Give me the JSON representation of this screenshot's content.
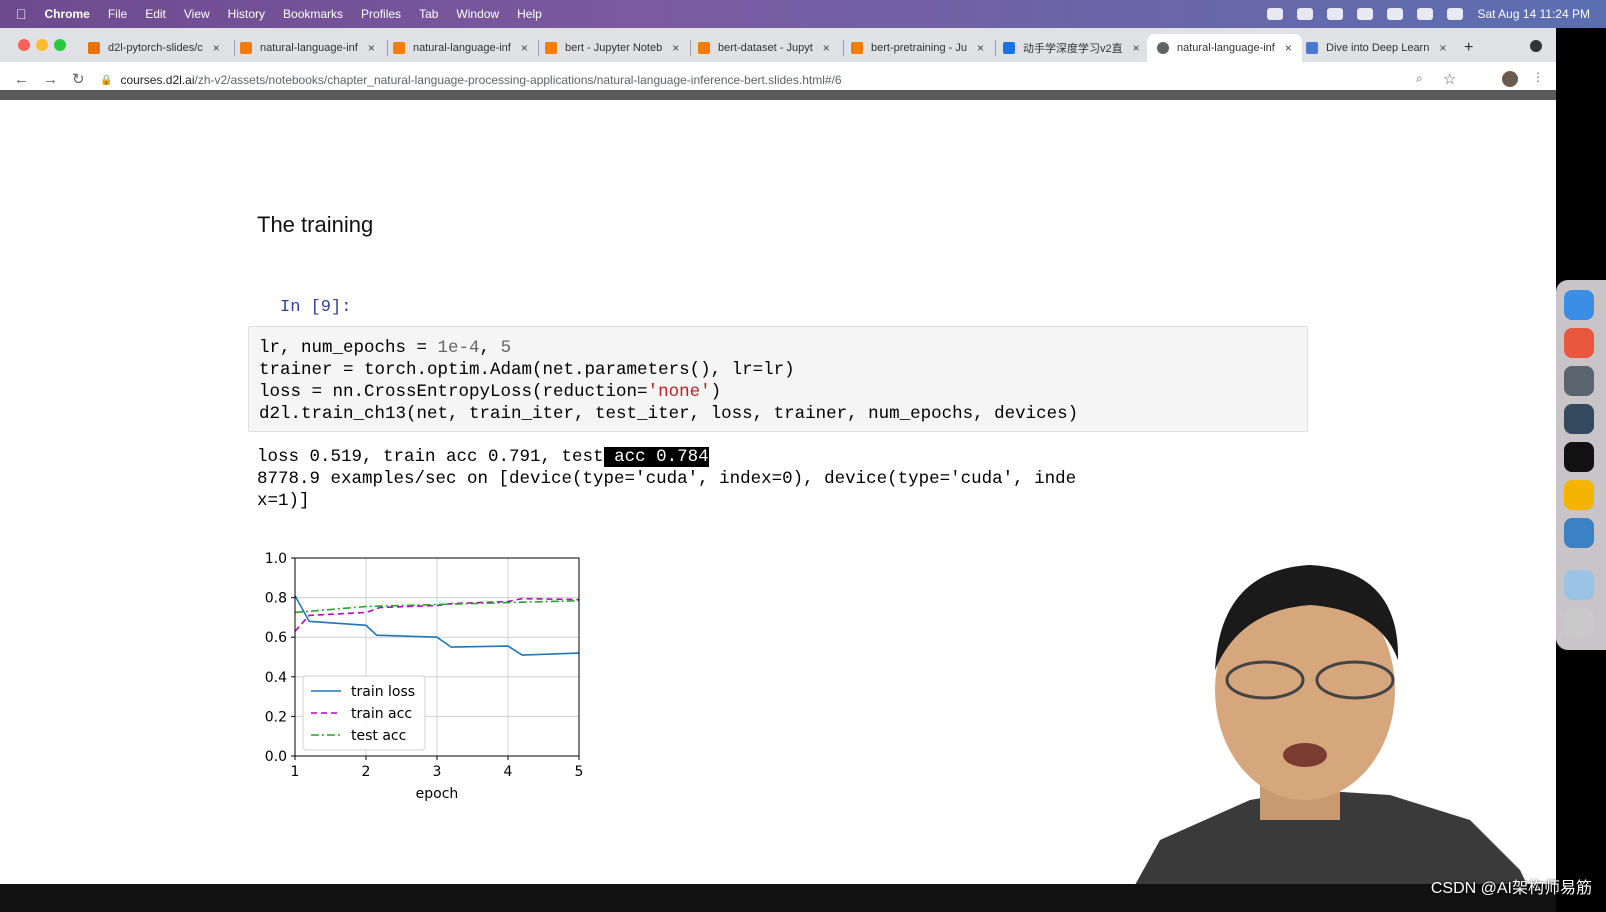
{
  "menubar": {
    "app": "Chrome",
    "items": [
      "File",
      "Edit",
      "View",
      "History",
      "Bookmarks",
      "Profiles",
      "Tab",
      "Window",
      "Help"
    ],
    "datetime": "Sat Aug 14  11:24 PM"
  },
  "tabs": [
    {
      "label": "d2l-pytorch-slides/c",
      "icon_color": "#e8710a"
    },
    {
      "label": "natural-language-inf",
      "icon_color": "#f57c00"
    },
    {
      "label": "natural-language-inf",
      "icon_color": "#f57c00"
    },
    {
      "label": "bert - Jupyter Noteb",
      "icon_color": "#f57c00"
    },
    {
      "label": "bert-dataset - Jupyt",
      "icon_color": "#f57c00"
    },
    {
      "label": "bert-pretraining - Ju",
      "icon_color": "#f57c00"
    },
    {
      "label": "动手学深度学习v2直",
      "icon_color": "#1a73e8"
    },
    {
      "label": "natural-language-inf",
      "icon_color": "#5f6368"
    },
    {
      "label": "Dive into Deep Learn",
      "icon_color": "#4a7bd0"
    }
  ],
  "new_tab_label": "+",
  "close_label": "×",
  "url": {
    "domain": "courses.d2l.ai",
    "path": "/zh-v2/assets/notebooks/chapter_natural-language-processing-applications/natural-language-inference-bert.slides.html#/6"
  },
  "nav": {
    "back": "←",
    "forward": "→",
    "reload": "↻",
    "lock": "🔒",
    "star": "☆",
    "zoom": "⌕",
    "menu": "⋮"
  },
  "page": {
    "heading": "The training",
    "prompt": "In [9]:",
    "code": {
      "line1_a": "lr, num_epochs = ",
      "line1_num": "1e-4",
      "line1_b": ", ",
      "line1_num2": "5",
      "line2": "trainer = torch.optim.Adam(net.parameters(), lr=lr)",
      "line3_a": "loss = nn.CrossEntropyLoss(reduction=",
      "line3_str": "'none'",
      "line3_b": ")",
      "line4": "d2l.train_ch13(net, train_iter, test_iter, loss, trainer, num_epochs, devices)"
    },
    "output": {
      "line1_a": "loss 0.519, train acc 0.791, test",
      "line1_hl": " acc 0.784",
      "line2": "8778.9 examples/sec on [device(type='cuda', index=0), device(type='cuda', inde",
      "line3": "x=1)]"
    }
  },
  "chart_data": {
    "type": "line",
    "xlabel": "epoch",
    "ylabel": "",
    "xlim": [
      1,
      5
    ],
    "ylim": [
      0.0,
      1.0
    ],
    "xticks": [
      "1",
      "2",
      "3",
      "4",
      "5"
    ],
    "yticks": [
      "0.0",
      "0.2",
      "0.4",
      "0.6",
      "0.8",
      "1.0"
    ],
    "grid": true,
    "legend_position": "lower-left",
    "series": [
      {
        "name": "train loss",
        "color": "#1f77b4",
        "dash": "solid",
        "x": [
          1.0,
          1.2,
          2.0,
          2.15,
          3.0,
          3.2,
          4.0,
          4.2,
          5.0
        ],
        "y": [
          0.81,
          0.68,
          0.66,
          0.61,
          0.6,
          0.55,
          0.555,
          0.51,
          0.52
        ]
      },
      {
        "name": "train acc",
        "color": "#bf00bf",
        "dash": "dashed",
        "x": [
          1.0,
          1.2,
          2.0,
          2.2,
          3.0,
          3.2,
          4.0,
          4.2,
          5.0
        ],
        "y": [
          0.63,
          0.71,
          0.725,
          0.75,
          0.76,
          0.77,
          0.78,
          0.795,
          0.79
        ]
      },
      {
        "name": "test acc",
        "color": "#2ca02c",
        "dash": "dashdot",
        "x": [
          1,
          2,
          3,
          4,
          5
        ],
        "y": [
          0.725,
          0.755,
          0.765,
          0.775,
          0.784
        ]
      }
    ]
  },
  "watermark": "CSDN @AI架构师易筋"
}
